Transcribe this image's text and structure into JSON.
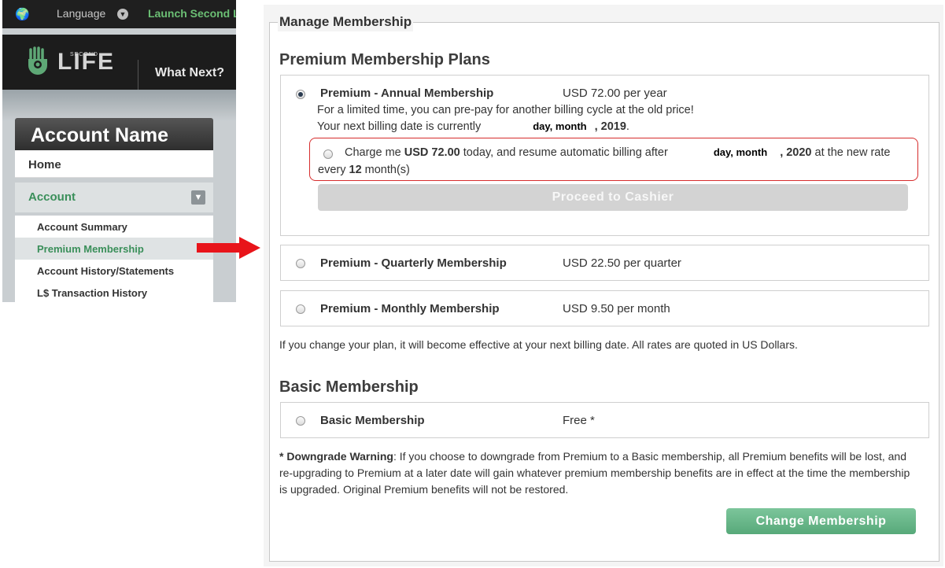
{
  "top_bar": {
    "language_label": "Language",
    "launch_label": "Launch Second Life"
  },
  "header": {
    "logo_small": "SECOND",
    "logo_text": "LIFE",
    "what_next": "What Next?"
  },
  "sidebar": {
    "account_name": "Account Name",
    "home": "Home",
    "account": "Account",
    "items": [
      {
        "label": "Account Summary"
      },
      {
        "label": "Premium Membership"
      },
      {
        "label": "Account History/Statements"
      },
      {
        "label": "L$ Transaction History"
      }
    ]
  },
  "manage": {
    "legend": "Manage Membership",
    "premium_title": "Premium Membership Plans",
    "annual": {
      "name": "Premium - Annual Membership",
      "price": "USD 72.00 per year",
      "line1": "For a limited time, you can pre-pay for another billing cycle at the old price!",
      "line2_prefix": "Your next billing date is currently",
      "line2_date": "day, month",
      "line2_year": ", 2019",
      "line2_end": ".",
      "charge_prefix": "Charge me ",
      "charge_amount": "USD 72.00",
      "charge_mid": " today, and resume automatic billing after",
      "charge_date": "day, month",
      "charge_year": ", 2020",
      "charge_end": " at the new rate",
      "every_prefix": "every ",
      "every_num": "12",
      "every_suffix": " month(s)",
      "cashier_button": "Proceed to Cashier"
    },
    "quarterly": {
      "name": "Premium - Quarterly Membership",
      "price": "USD 22.50 per quarter"
    },
    "monthly": {
      "name": "Premium - Monthly Membership",
      "price": "USD 9.50 per month"
    },
    "plan_note": "If you change your plan, it will become effective at your next billing date. All rates are quoted in US Dollars.",
    "basic_title": "Basic Membership",
    "basic": {
      "name": "Basic Membership",
      "price": "Free *"
    },
    "warning_label": "* Downgrade Warning",
    "warning_text": ": If you choose to downgrade from Premium to a Basic membership, all Premium benefits will be lost, and re-upgrading to Premium at a later date will gain whatever premium membership benefits are in effect at the time the membership is upgraded. Original Premium benefits will not be restored.",
    "change_button": "Change Membership"
  },
  "colors": {
    "accent_green": "#57a97a",
    "highlight_red": "#d62c2c",
    "arrow_red": "#e8141a"
  }
}
